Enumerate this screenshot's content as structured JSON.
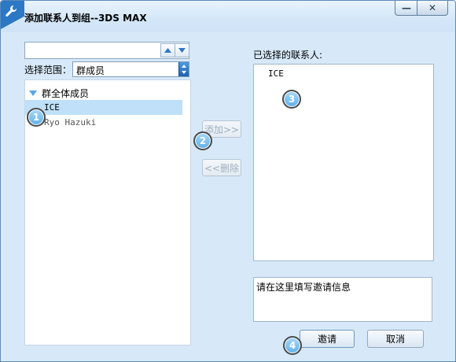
{
  "window": {
    "title": "添加联系人到组--3DS MAX",
    "minimize_glyph": "—",
    "close_glyph": "✕"
  },
  "left": {
    "search_value": "",
    "scope_label": "选择范围：",
    "scope_value": "群成员",
    "group_name": "群全体成员",
    "contacts": [
      {
        "name": "ICE",
        "selected": true
      },
      {
        "name": "Ryo Hazuki",
        "selected": false
      }
    ]
  },
  "middle": {
    "add_label": "添加>>",
    "remove_label": "<<删除"
  },
  "right": {
    "selected_label": "已选择的联系人:",
    "selected_contacts": [
      "ICE"
    ],
    "invite_message": "请在这里填写邀请信息"
  },
  "footer": {
    "invite_label": "邀请",
    "cancel_label": "取消"
  },
  "annotations": {
    "one": "1",
    "two": "2",
    "three": "3",
    "four": "4"
  },
  "colors": {
    "accent": "#2d78c4",
    "selected_row": "#bfe0f8",
    "window_bg": "#d7e9f8"
  }
}
